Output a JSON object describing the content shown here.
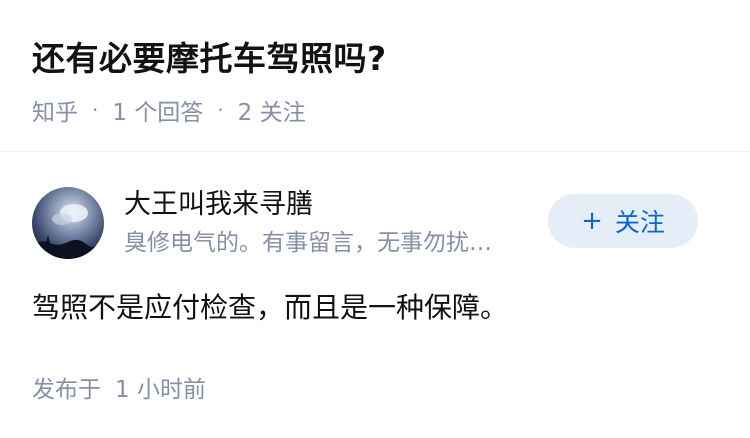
{
  "question": {
    "title": "还有必要摩托车驾照吗?",
    "source": "知乎",
    "separator": "·",
    "answer_count": "1 个回答",
    "follower_count": "2 关注"
  },
  "author": {
    "name": "大王叫我来寻膳",
    "bio": "臭修电气的。有事留言，无事勿扰…",
    "avatar_icon": "sky-cloud-avatar"
  },
  "follow_button": {
    "plus": "+",
    "label": "关注"
  },
  "answer": {
    "content": "驾照不是应付检查，而且是一种保障。",
    "published_label": "发布于",
    "published_time": "1 小时前"
  },
  "colors": {
    "meta_gray": "#8590a6",
    "accent_blue": "#0a66d6",
    "button_bg": "#e5eef8"
  }
}
